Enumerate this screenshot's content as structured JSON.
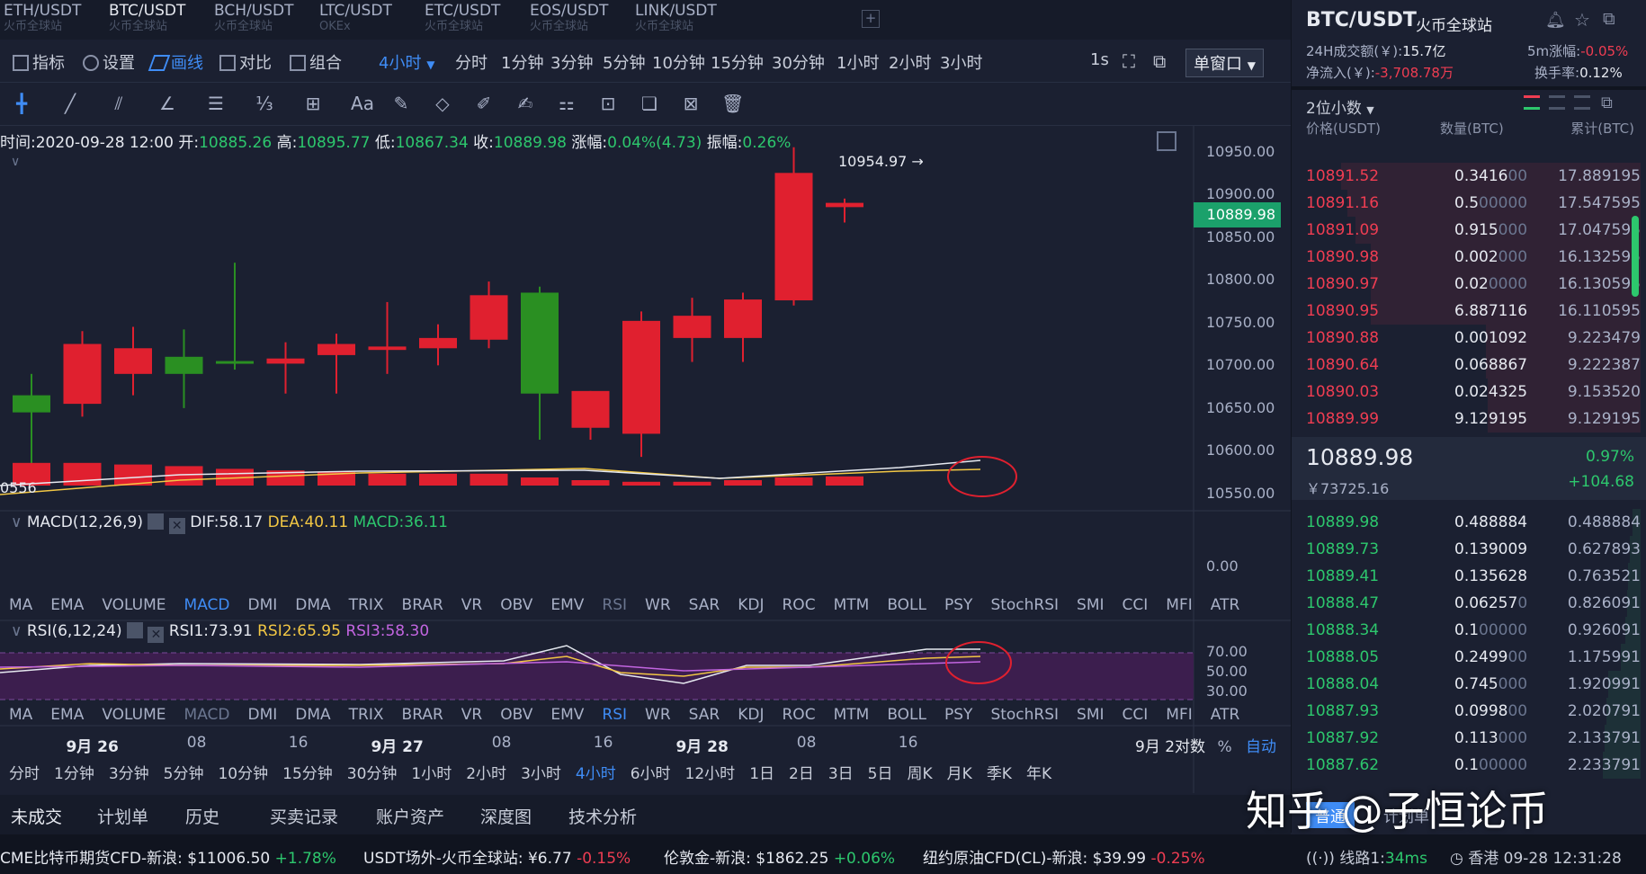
{
  "colors": {
    "up": "#2dc76d",
    "down": "#ef3d52",
    "bg": "#1b2031",
    "accent": "#3f8cf5"
  },
  "tabs": [
    {
      "title": "ETH/USDT",
      "sub": "火币全球站",
      "active": false
    },
    {
      "title": "BTC/USDT",
      "sub": "火币全球站",
      "active": true
    },
    {
      "title": "BCH/USDT",
      "sub": "火币全球站",
      "active": false
    },
    {
      "title": "LTC/USDT",
      "sub": "OKEx",
      "active": false
    },
    {
      "title": "ETC/USDT",
      "sub": "火币全球站",
      "active": false
    },
    {
      "title": "EOS/USDT",
      "sub": "火币全球站",
      "active": false
    },
    {
      "title": "LINK/USDT",
      "sub": "火币全球站",
      "active": false
    }
  ],
  "add_tab": "+",
  "toolbar": {
    "indicator": "指标",
    "settings": "设置",
    "draw": "画线",
    "compare": "对比",
    "combine": "组合",
    "interval": "4小时",
    "intervals": [
      "分时",
      "1分钟",
      "3分钟",
      "5分钟",
      "10分钟",
      "15分钟",
      "30分钟",
      "1小时",
      "2小时",
      "3小时"
    ],
    "refresh": "1s",
    "window_mode": "单窗口"
  },
  "draw_tools": [
    "crosshair-icon",
    "line-icon",
    "parallel-icon",
    "angle-icon",
    "hline-icon",
    "fib-icon",
    "measure-icon",
    "text-icon",
    "pattern-icon",
    "shape-icon",
    "pen-icon",
    "brush-icon",
    "gann-icon",
    "lock-icon",
    "copy-icon",
    "screenshot-icon",
    "trash-icon"
  ],
  "draw_text_tool": "Aa",
  "ohlc": {
    "time_label": "时间:",
    "time": "2020-09-28 12:00",
    "open_label": "开:",
    "open": "10885.26",
    "high_label": "高:",
    "high": "10895.77",
    "low_label": "低:",
    "low": "10867.34",
    "close_label": "收:",
    "close": "10889.98",
    "chg_label": "涨幅:",
    "chg": "0.04%(4.73)",
    "amp_label": "振幅:",
    "amp": "0.26%"
  },
  "chart_data": {
    "type": "candlestick",
    "y_ticks": [
      "10950.00",
      "10900.00",
      "10850.00",
      "10800.00",
      "10750.00",
      "10700.00",
      "10650.00",
      "10600.00",
      "10550.00"
    ],
    "ylim": [
      10530,
      10980
    ],
    "last_price": "10889.98",
    "high_marker": "10954.97 →",
    "low_marker": "0556",
    "candles": [
      {
        "o": 10665,
        "h": 10690,
        "l": 10575,
        "c": 10645
      },
      {
        "o": 10655,
        "h": 10740,
        "l": 10640,
        "c": 10725
      },
      {
        "o": 10690,
        "h": 10745,
        "l": 10665,
        "c": 10720
      },
      {
        "o": 10710,
        "h": 10742,
        "l": 10650,
        "c": 10690
      },
      {
        "o": 10705,
        "h": 10820,
        "l": 10695,
        "c": 10705
      },
      {
        "o": 10702,
        "h": 10727,
        "l": 10667,
        "c": 10708
      },
      {
        "o": 10712,
        "h": 10737,
        "l": 10667,
        "c": 10725
      },
      {
        "o": 10718,
        "h": 10774,
        "l": 10690,
        "c": 10722
      },
      {
        "o": 10720,
        "h": 10748,
        "l": 10700,
        "c": 10732
      },
      {
        "o": 10730,
        "h": 10798,
        "l": 10720,
        "c": 10782
      },
      {
        "o": 10785,
        "h": 10792,
        "l": 10613,
        "c": 10667
      },
      {
        "o": 10627,
        "h": 10670,
        "l": 10613,
        "c": 10670
      },
      {
        "o": 10620,
        "h": 10763,
        "l": 10593,
        "c": 10752
      },
      {
        "o": 10732,
        "h": 10779,
        "l": 10704,
        "c": 10758
      },
      {
        "o": 10732,
        "h": 10785,
        "l": 10704,
        "c": 10777
      },
      {
        "o": 10776,
        "h": 10955,
        "l": 10770,
        "c": 10925
      },
      {
        "o": 10885,
        "h": 10895,
        "l": 10867,
        "c": 10890
      }
    ],
    "x_ticks": [
      {
        "label": "9月 26",
        "bold": true,
        "i": 1.3
      },
      {
        "label": "08",
        "bold": false,
        "i": 3.5
      },
      {
        "label": "16",
        "bold": false,
        "i": 5.5
      },
      {
        "label": "9月 27",
        "bold": true,
        "i": 7.3
      },
      {
        "label": "08",
        "bold": false,
        "i": 9.5
      },
      {
        "label": "16",
        "bold": false,
        "i": 11.5
      },
      {
        "label": "9月 28",
        "bold": true,
        "i": 13.3
      },
      {
        "label": "08",
        "bold": false,
        "i": 15.5
      },
      {
        "label": "16",
        "bold": false,
        "i": 17.5
      }
    ],
    "x_right": "9月 2对数",
    "pct": "%",
    "auto": "自动"
  },
  "macd": {
    "label": "MACD(12,26,9)",
    "dif": "DIF:58.17",
    "dea": "DEA:40.11",
    "macd": "MACD:36.11",
    "zero": "0.00",
    "hist": [
      0.84,
      0.84,
      0.78,
      0.72,
      0.62,
      0.56,
      0.5,
      0.44,
      0.44,
      0.44,
      0.3,
      0.2,
      0.14,
      0.14,
      0.2,
      0.3,
      0.34
    ]
  },
  "rsi": {
    "label": "RSI(6,12,24)",
    "r1": "RSI1:73.91",
    "r2": "RSI2:65.95",
    "r3": "RSI3:58.30",
    "ticks": [
      "70.00",
      "50.00",
      "30.00"
    ]
  },
  "indicators": [
    "MA",
    "EMA",
    "VOLUME",
    "MACD",
    "DMI",
    "DMA",
    "TRIX",
    "BRAR",
    "VR",
    "OBV",
    "EMV",
    "RSI",
    "WR",
    "SAR",
    "KDJ",
    "ROC",
    "MTM",
    "BOLL",
    "PSY",
    "StochRSI",
    "SMI",
    "CCI",
    "MFI",
    "ATR"
  ],
  "periods": [
    "分时",
    "1分钟",
    "3分钟",
    "5分钟",
    "10分钟",
    "15分钟",
    "30分钟",
    "1小时",
    "2小时",
    "3小时",
    "4小时",
    "6小时",
    "12小时",
    "1日",
    "2日",
    "3日",
    "5日",
    "周K",
    "月K",
    "季K",
    "年K"
  ],
  "bottom_tabs": [
    "未成交",
    "计划单",
    "历史",
    "买卖记录",
    "账户资产",
    "深度图",
    "技术分析"
  ],
  "side": {
    "pair": "BTC/USDT",
    "exchange": "火币全球站",
    "vol_label": "24H成交额(￥):",
    "vol": "15.7亿",
    "rise5m_label": "5m涨幅:",
    "rise5m": "-0.05%",
    "inflow_label": "净流入(￥):",
    "inflow": "-3,708.78万",
    "turnover_label": "换手率:",
    "turnover": "0.12%",
    "decimals": "2位小数",
    "headers": [
      "价格(USDT)",
      "数量(BTC)",
      "累计(BTC)"
    ],
    "asks": [
      [
        "10891.52",
        "0.3416",
        "00",
        "17.889195"
      ],
      [
        "10891.16",
        "0.5",
        "00000",
        "17.547595"
      ],
      [
        "10891.09",
        "0.915",
        "000",
        "17.047595"
      ],
      [
        "10890.98",
        "0.002",
        "000",
        "16.132595"
      ],
      [
        "10890.97",
        "0.02",
        "0000",
        "16.130595"
      ],
      [
        "10890.95",
        "6.887116",
        "",
        "16.110595"
      ],
      [
        "10890.88",
        "0.001092",
        "",
        "9.223479"
      ],
      [
        "10890.64",
        "0.068867",
        "",
        "9.222387"
      ],
      [
        "10890.03",
        "0.024325",
        "",
        "9.153520"
      ],
      [
        "10889.99",
        "9.129195",
        "",
        "9.129195"
      ]
    ],
    "last": "10889.98",
    "last_cny": "￥73725.16",
    "chg_pct": "0.97%",
    "chg_abs": "+104.68",
    "bids": [
      [
        "10889.98",
        "0.488884",
        "",
        "0.488884"
      ],
      [
        "10889.73",
        "0.139009",
        "",
        "0.627893"
      ],
      [
        "10889.41",
        "0.135628",
        "",
        "0.763521"
      ],
      [
        "10888.47",
        "0.06257",
        "0",
        "0.826091"
      ],
      [
        "10888.34",
        "0.1",
        "00000",
        "0.926091"
      ],
      [
        "10888.05",
        "0.2499",
        "00",
        "1.175991"
      ],
      [
        "10888.04",
        "0.745",
        "000",
        "1.920991"
      ],
      [
        "10887.93",
        "0.0998",
        "00",
        "2.020791"
      ],
      [
        "10887.92",
        "0.113",
        "000",
        "2.133791"
      ],
      [
        "10887.62",
        "0.1",
        "00000",
        "2.233791"
      ]
    ],
    "order_mode": "普通",
    "plan": "计划单"
  },
  "ticker": [
    {
      "name": "CME比特币期货CFD-新浪:",
      "price": "$11006.50",
      "chg": "+1.78%",
      "up": true
    },
    {
      "name": "USDT场外-火币全球站:",
      "price": "¥6.77",
      "chg": "-0.15%",
      "up": false
    },
    {
      "name": "伦敦金-新浪:",
      "price": "$1862.25",
      "chg": "+0.06%",
      "up": true
    },
    {
      "name": "纽约原油CFD(CL)-新浪:",
      "price": "$39.99",
      "chg": "-0.25%",
      "up": false
    }
  ],
  "status": {
    "line": "线路1:",
    "latency": "34ms",
    "location": "香港",
    "time": "09-28 12:31:28"
  },
  "watermark": "知乎 @子恒论币"
}
